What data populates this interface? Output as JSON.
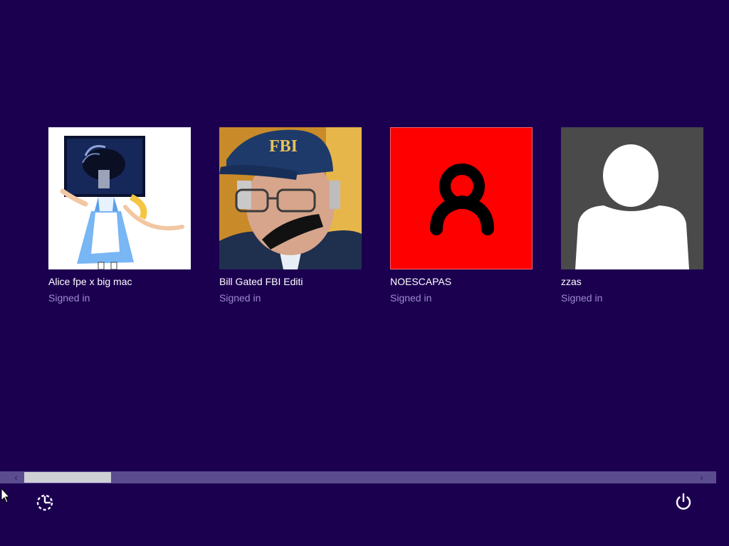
{
  "accounts": [
    {
      "name": "Alice fpe x big mac",
      "status": "Signed in",
      "avatar_icon": "alice-cartoon-avatar"
    },
    {
      "name": "Bill Gated FBI Editi",
      "status": "Signed in",
      "avatar_icon": "fbi-cap-portrait-avatar"
    },
    {
      "name": "NOESCAPAS",
      "status": "Signed in",
      "avatar_icon": "red-user-symbol-avatar",
      "avatar_color": "#ff0000"
    },
    {
      "name": "zzas",
      "status": "Signed in",
      "avatar_icon": "default-user-silhouette-avatar",
      "avatar_color": "#4a4a4a"
    }
  ],
  "colors": {
    "background": "#1c0050",
    "status_text": "#9c8bd0",
    "scrollbar_track": "#5b4b8f",
    "scrollbar_thumb": "#cfcfd6"
  },
  "footer": {
    "ease_of_access_icon": "ease-of-access-icon",
    "power_icon": "power-icon"
  },
  "scrollbar": {
    "left_arrow": "‹",
    "right_arrow": "›"
  }
}
